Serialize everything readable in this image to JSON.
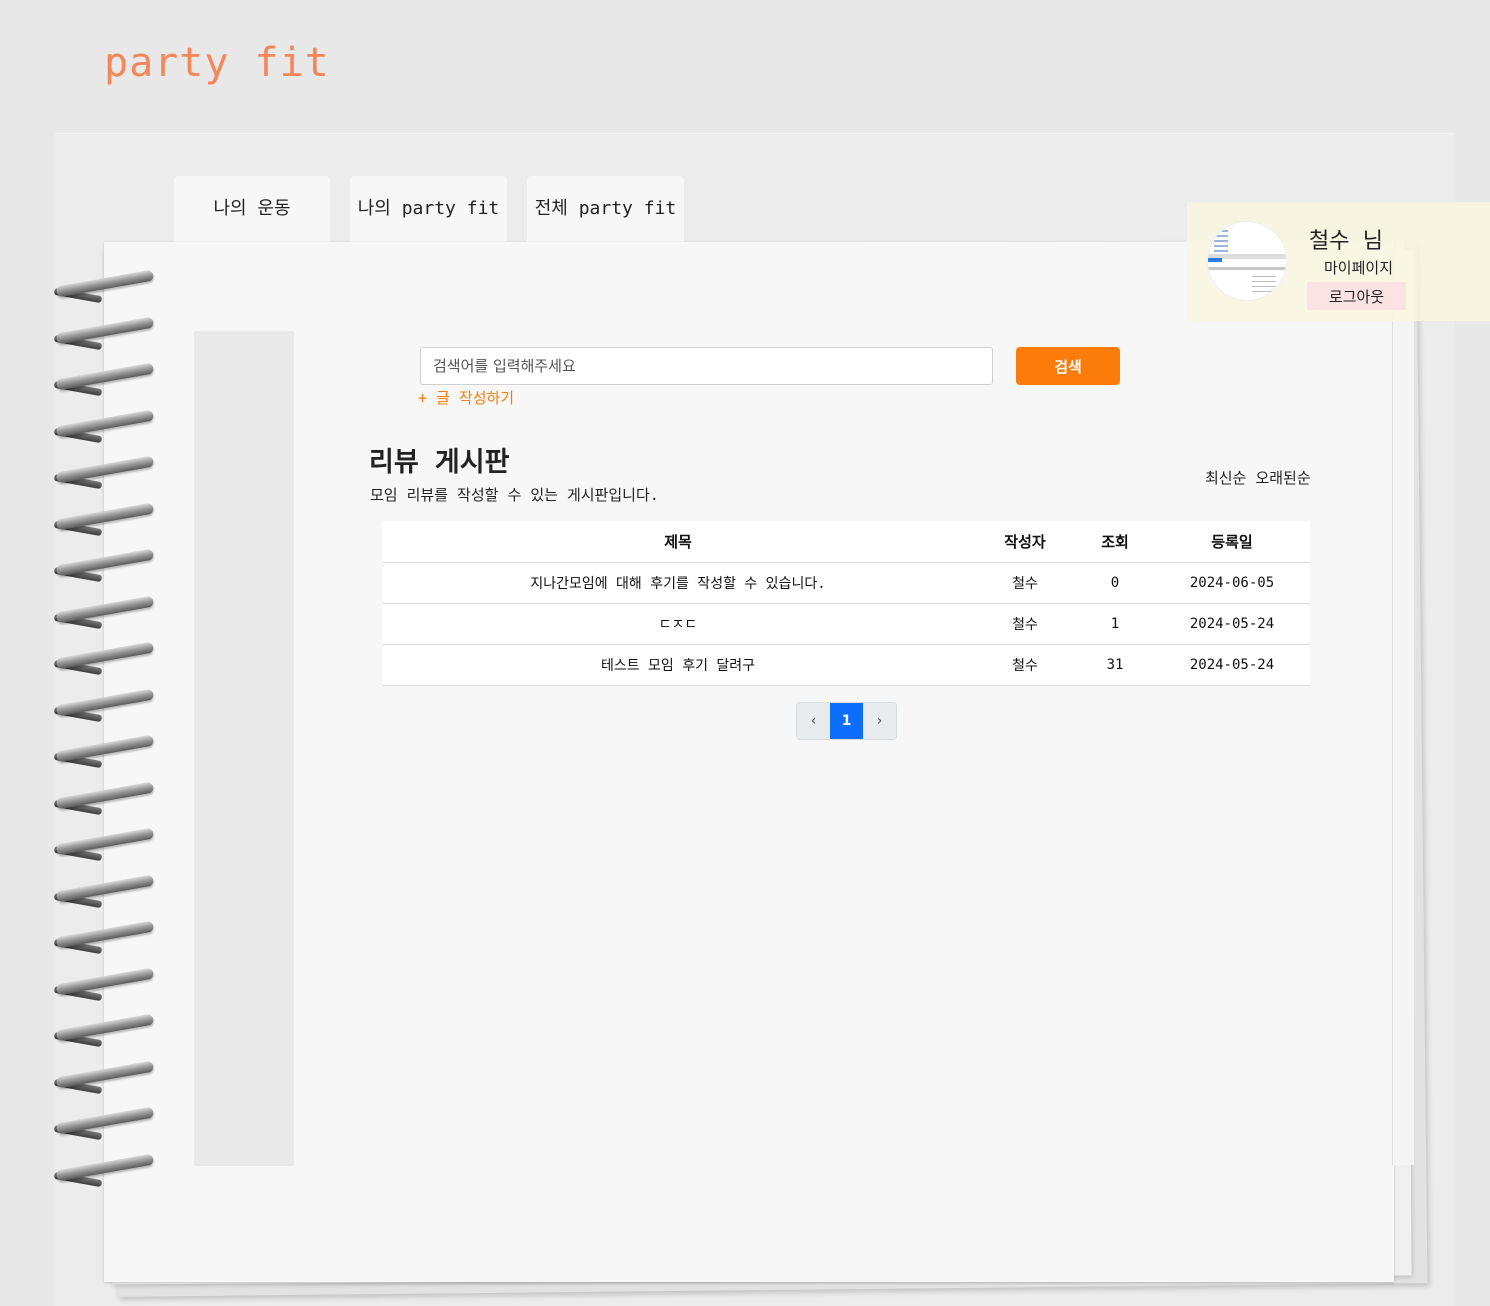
{
  "logo": "party fit",
  "tabs": [
    {
      "label": "나의 운동"
    },
    {
      "label": "나의 party fit"
    },
    {
      "label": "전체 party fit"
    }
  ],
  "profile": {
    "name": "철수 님",
    "mypage": "마이페이지",
    "logout": "로그아웃"
  },
  "search": {
    "placeholder": "검색어를 입력해주세요",
    "button": "검색"
  },
  "write_link": "+ 글 작성하기",
  "board": {
    "title": "리뷰 게시판",
    "description": "모임 리뷰를 작성할 수 있는 게시판입니다.",
    "sort_newest": "최신순",
    "sort_oldest": "오래된순",
    "columns": [
      "제목",
      "작성자",
      "조회",
      "등록일"
    ],
    "rows": [
      {
        "title": "지나간모임에 대해 후기를 작성할 수 있습니다.",
        "author": "철수",
        "views": "0",
        "date": "2024-06-05"
      },
      {
        "title": "ㄷㅈㄷ",
        "author": "철수",
        "views": "1",
        "date": "2024-05-24"
      },
      {
        "title": "테스트 모임 후기 달려구",
        "author": "철수",
        "views": "31",
        "date": "2024-05-24"
      }
    ]
  },
  "pagination": {
    "prev": "‹",
    "current": "1",
    "next": "›"
  },
  "colors": {
    "logo": "#f4875a",
    "accent": "#fb7c0b",
    "page_active": "#0d6efd",
    "logout_bg": "#fbe3e3"
  }
}
